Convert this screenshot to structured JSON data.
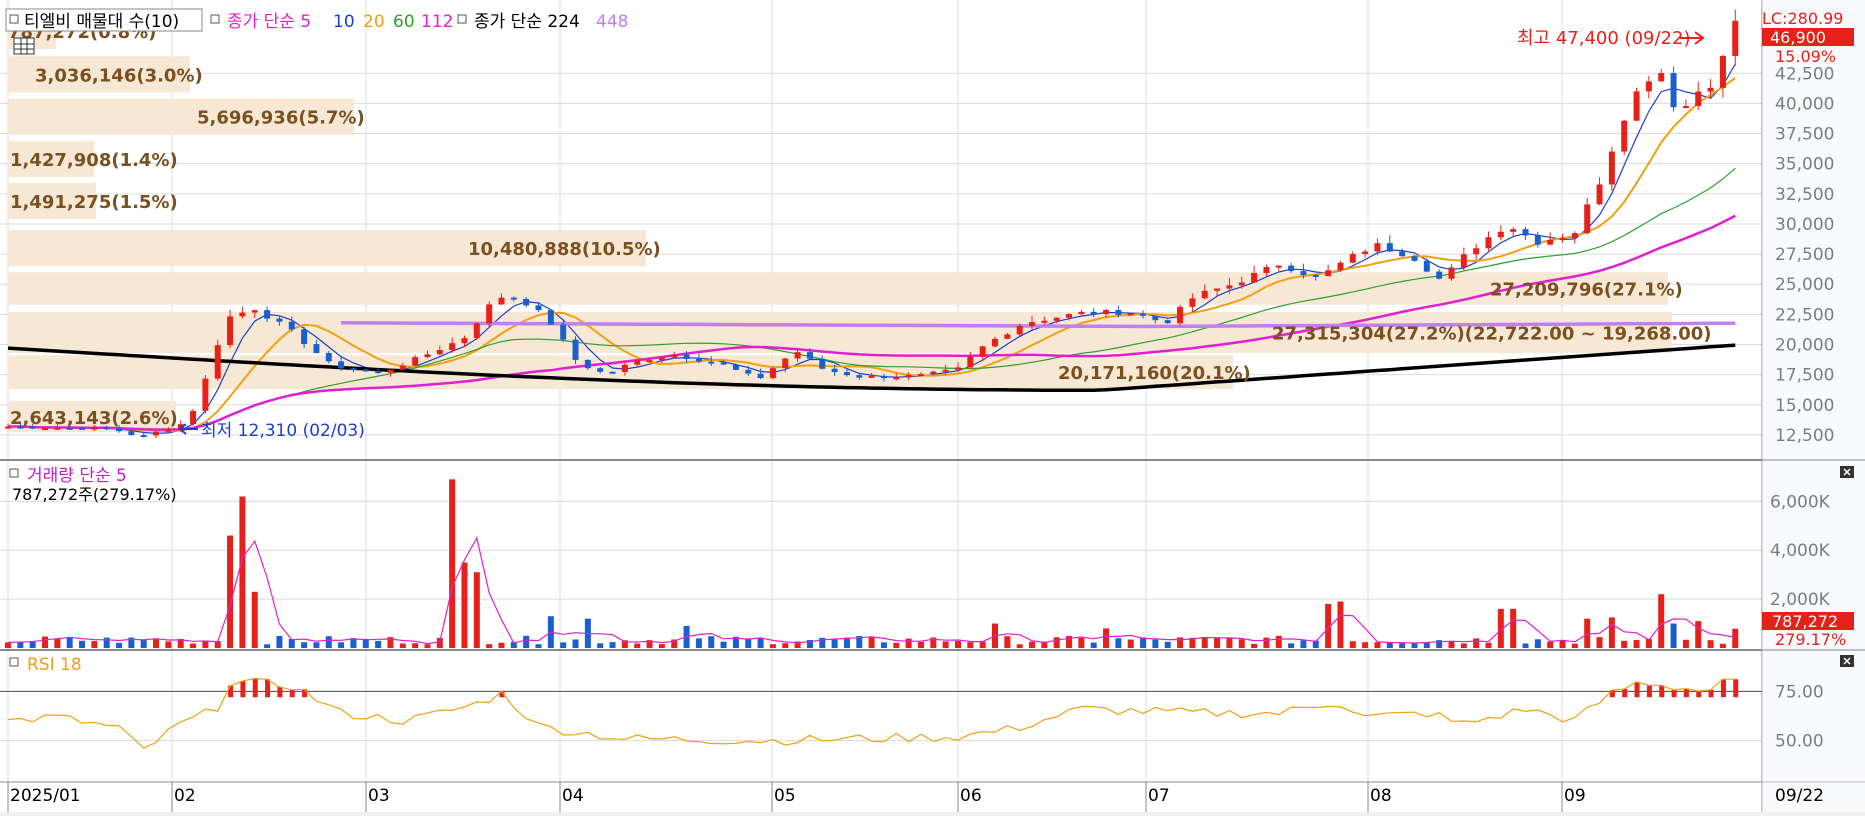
{
  "legend": {
    "price": [
      "티엘비 매물대 수(10)",
      "종가 단순 5",
      "10",
      "20",
      "60",
      "112",
      "종가 단순 224",
      "448"
    ],
    "volume": [
      "거래량 단순 5",
      "787,272주(279.17%)"
    ],
    "rsi": "RSI 18"
  },
  "colors": {
    "up": "#e8201a",
    "down": "#1a5fd0",
    "ma5": "#1a3fcc",
    "ma10": "#1a3fcc",
    "ma20": "#f0a010",
    "ma60": "#2ea02e",
    "ma112": "#e020d0",
    "ma224": "#000000",
    "ma448": "#c080f0",
    "profile": "#f7e8d5",
    "profile_text": "#7a5020",
    "grid": "#dcdcdc"
  },
  "price_axis": {
    "ticks": [
      "42,500",
      "40,000",
      "37,500",
      "35,000",
      "32,500",
      "30,000",
      "27,500",
      "25,000",
      "22,500",
      "20,000",
      "17,500",
      "15,000",
      "12,500"
    ],
    "tick_values": [
      42500,
      40000,
      37500,
      35000,
      32500,
      30000,
      27500,
      25000,
      22500,
      20000,
      17500,
      15000,
      12500
    ],
    "lc_label": "LC:280.99",
    "current_label": "46,900",
    "pct_label": "15.09%",
    "range": [
      11000,
      47500
    ]
  },
  "volume_axis": {
    "ticks": [
      "6,000K",
      "4,000K",
      "2,000K"
    ],
    "tick_values": [
      6000,
      4000,
      2000
    ],
    "current_label": "787,272",
    "pct_label": "279.17%",
    "range": [
      0,
      7200
    ]
  },
  "rsi_axis": {
    "ticks": [
      "75.00",
      "50.00"
    ],
    "tick_values": [
      75,
      50
    ],
    "range": [
      30,
      95
    ]
  },
  "time_axis": {
    "labels": [
      "2025/01",
      "02",
      "03",
      "04",
      "05",
      "06",
      "07",
      "08",
      "09"
    ],
    "last_date": "09/22"
  },
  "annotations": {
    "high": "최고 47,400 (09/22)",
    "low": "최저 12,310 (02/03)"
  },
  "chart_data": {
    "type": "candlestick",
    "volume_profile": [
      {
        "label": "787,272(0.8%)",
        "range": [
          44500,
          47500
        ]
      },
      {
        "label": "3,036,146(3.0%)",
        "range": [
          40900,
          43900
        ]
      },
      {
        "label": "5,696,936(5.7%)",
        "range": [
          37400,
          40400
        ]
      },
      {
        "label": "1,427,908(1.4%)",
        "range": [
          33900,
          36900
        ]
      },
      {
        "label": "1,491,275(1.5%)",
        "range": [
          30400,
          33400
        ]
      },
      {
        "label": "10,480,888(10.5%)",
        "range": [
          26500,
          29500
        ]
      },
      {
        "label": "27,209,796(27.1%)",
        "range": [
          23300,
          26000
        ]
      },
      {
        "label": "27,315,304(27.2%)(22,722.00 ~ 19,268.00)",
        "range": [
          19300,
          22700
        ]
      },
      {
        "label": "20,171,160(20.1%)",
        "range": [
          16300,
          19100
        ]
      },
      {
        "label": "2,643,143(2.6%)",
        "range": [
          12700,
          15300
        ]
      }
    ],
    "price": {
      "high": 47400,
      "high_date": "09/22",
      "low": 12310,
      "low_date": "02/03",
      "last": 46900
    },
    "volume_last": 787272,
    "rsi_last": 80
  }
}
